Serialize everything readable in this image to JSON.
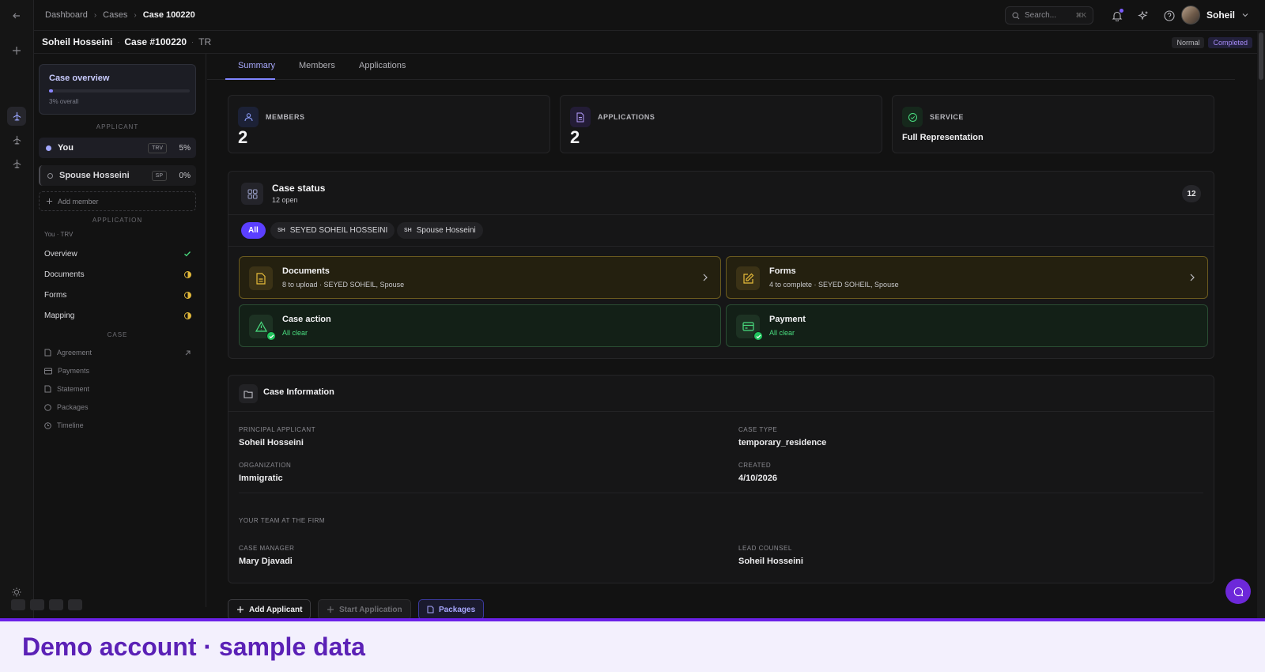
{
  "breadcrumb": {
    "items": [
      "Dashboard",
      "Cases"
    ],
    "current": "Case 100220"
  },
  "search": {
    "placeholder": "Search...",
    "shortcut": "⌘K"
  },
  "user": {
    "name": "Soheil"
  },
  "case_header": {
    "applicant": "Soheil Hosseini",
    "case_no": "Case #100220",
    "type_code": "TR"
  },
  "badges": {
    "priority": "Normal",
    "status": "Completed"
  },
  "sidebar": {
    "overview": {
      "title": "Case overview",
      "subtitle": "3% overall",
      "progress": 0.03
    },
    "applicant_label": "APPLICANT",
    "members": [
      {
        "name": "You",
        "tag": "TRV",
        "percent": "5%"
      },
      {
        "name": "Spouse Hosseini",
        "tag": "SP",
        "percent": "0%"
      }
    ],
    "add_member": "Add member",
    "application_label": "APPLICATION",
    "application_sub": "You · TRV",
    "application_items": [
      {
        "label": "Overview",
        "status": "done"
      },
      {
        "label": "Documents",
        "status": "partial"
      },
      {
        "label": "Forms",
        "status": "partial"
      },
      {
        "label": "Mapping",
        "status": "partial"
      }
    ],
    "case_label": "CASE",
    "case_items": [
      "Agreement",
      "Payments",
      "Statement",
      "Packages",
      "Timeline"
    ]
  },
  "tabs": [
    "Summary",
    "Members",
    "Applications"
  ],
  "stats": {
    "members": {
      "label": "MEMBERS",
      "value": "2"
    },
    "applications": {
      "label": "APPLICATIONS",
      "value": "2"
    },
    "service": {
      "label": "SERVICE",
      "value": "Full Representation"
    }
  },
  "case_status": {
    "title": "Case status",
    "subtitle": "12 open",
    "count": "12",
    "filters": [
      {
        "label": "All"
      },
      {
        "initials": "SH",
        "label": "SEYED SOHEIL HOSSEINI"
      },
      {
        "initials": "SH",
        "label": "Spouse Hosseini"
      }
    ],
    "tasks": [
      {
        "title": "Documents",
        "subtitle": "8 to upload · SEYED SOHEIL, Spouse"
      },
      {
        "title": "Forms",
        "subtitle": "4 to complete · SEYED SOHEIL, Spouse"
      },
      {
        "title": "Case action",
        "subtitle": "All clear"
      },
      {
        "title": "Payment",
        "subtitle": "All clear"
      }
    ]
  },
  "case_info": {
    "title": "Case Information",
    "principal_applicant": {
      "label": "PRINCIPAL APPLICANT",
      "value": "Soheil Hosseini"
    },
    "case_type": {
      "label": "CASE TYPE",
      "value": "temporary_residence"
    },
    "organization": {
      "label": "ORGANIZATION",
      "value": "Immigratic"
    },
    "created": {
      "label": "CREATED",
      "value": "4/10/2026"
    },
    "team_label": "YOUR TEAM AT THE FIRM",
    "case_manager": {
      "label": "CASE MANAGER",
      "value": "Mary Djavadi"
    },
    "lead_counsel": {
      "label": "LEAD COUNSEL",
      "value": "Soheil Hosseini"
    }
  },
  "actions": {
    "add_applicant": "Add Applicant",
    "start_application": "Start Application",
    "packages": "Packages"
  },
  "banner": {
    "text": "Demo account · sample data"
  },
  "colors": {
    "accent": "#8085ff",
    "warning": "#e6bb3a",
    "success": "#4ade80",
    "banner": "#6b21e8"
  }
}
